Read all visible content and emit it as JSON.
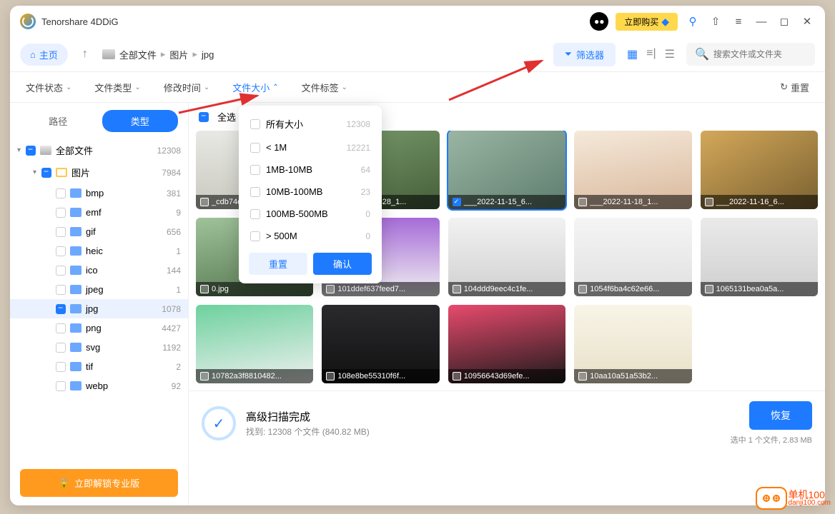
{
  "app_title": "Tenorshare 4DDiG",
  "buy_label": "立即购买",
  "home_label": "主页",
  "breadcrumb": [
    "全部文件",
    "图片",
    "jpg"
  ],
  "filter_btn": "筛选器",
  "search_placeholder": "搜索文件或文件夹",
  "filter_bar": {
    "file_status": "文件状态",
    "file_type": "文件类型",
    "modify_time": "修改时间",
    "file_size": "文件大小",
    "file_tag": "文件标签",
    "reset": "重置"
  },
  "sidebar_tabs": {
    "path": "路径",
    "type": "类型"
  },
  "tree": {
    "root": {
      "label": "全部文件",
      "count": "12308"
    },
    "pic": {
      "label": "图片",
      "count": "7984"
    },
    "items": [
      {
        "label": "bmp",
        "count": "381"
      },
      {
        "label": "emf",
        "count": "9"
      },
      {
        "label": "gif",
        "count": "656"
      },
      {
        "label": "heic",
        "count": "1"
      },
      {
        "label": "ico",
        "count": "144"
      },
      {
        "label": "jpeg",
        "count": "1"
      },
      {
        "label": "jpg",
        "count": "1078"
      },
      {
        "label": "png",
        "count": "4427"
      },
      {
        "label": "svg",
        "count": "1192"
      },
      {
        "label": "tif",
        "count": "2"
      },
      {
        "label": "webp",
        "count": "92"
      }
    ]
  },
  "unlock_btn": "立即解锁专业版",
  "select_all": "全选",
  "dropdown": {
    "items": [
      {
        "label": "所有大小",
        "count": "12308"
      },
      {
        "label": "< 1M",
        "count": "12221"
      },
      {
        "label": "1MB-10MB",
        "count": "64"
      },
      {
        "label": "10MB-100MB",
        "count": "23"
      },
      {
        "label": "100MB-500MB",
        "count": "0"
      },
      {
        "label": "> 500M",
        "count": "0"
      }
    ],
    "reset": "重置",
    "ok": "确认"
  },
  "thumbs": [
    {
      "name": "_cdb74e37_17000...",
      "bg": "linear-gradient(180deg,#e8e8e4,#c9c9c0)"
    },
    {
      "name": "___2022-10-28_1...",
      "bg": "linear-gradient(160deg,#7a9b6c,#455f3a)"
    },
    {
      "name": "___2022-11-15_6...",
      "bg": "linear-gradient(150deg,#9ab5a3,#5e7d6e)",
      "sel": true
    },
    {
      "name": "___2022-11-18_1...",
      "bg": "linear-gradient(170deg,#f5e9da,#d9b89c)"
    },
    {
      "name": "___2022-11-16_6...",
      "bg": "linear-gradient(150deg,#d4a85a,#7a6130)"
    },
    {
      "name": "0.jpg",
      "bg": "linear-gradient(170deg,#9fc29a,#567751)"
    },
    {
      "name": "101ddef637feed7...",
      "bg": "linear-gradient(180deg,#a66bd8,#f0f0f0)"
    },
    {
      "name": "104ddd9eec4c1fe...",
      "bg": "linear-gradient(180deg,#f2f2f2,#d0d0d0)"
    },
    {
      "name": "1054f6ba4c62e66...",
      "bg": "linear-gradient(180deg,#f5f5f5,#e0e0e0)"
    },
    {
      "name": "1065131bea0a5a...",
      "bg": "linear-gradient(180deg,#eaeaea,#cfcfcf)"
    },
    {
      "name": "10782a3f8810482...",
      "bg": "linear-gradient(170deg,#6dd19e,#f0f0f0)"
    },
    {
      "name": "108e8be55310f6f...",
      "bg": "linear-gradient(180deg,#2a2a2e,#111)"
    },
    {
      "name": "10956643d69efe...",
      "bg": "linear-gradient(170deg,#e84a6d,#1a1a1a)"
    },
    {
      "name": "10aa10a51a53b2...",
      "bg": "linear-gradient(180deg,#f8f5e8,#e8e0c8)"
    }
  ],
  "footer": {
    "done_title": "高级扫描完成",
    "done_sub": "找到: 12308 个文件 (840.82 MB)",
    "recover": "恢复",
    "selected": "选中 1 个文件, 2.83 MB"
  },
  "watermark": {
    "line1": "单机100",
    "line2": "danji100.com"
  }
}
